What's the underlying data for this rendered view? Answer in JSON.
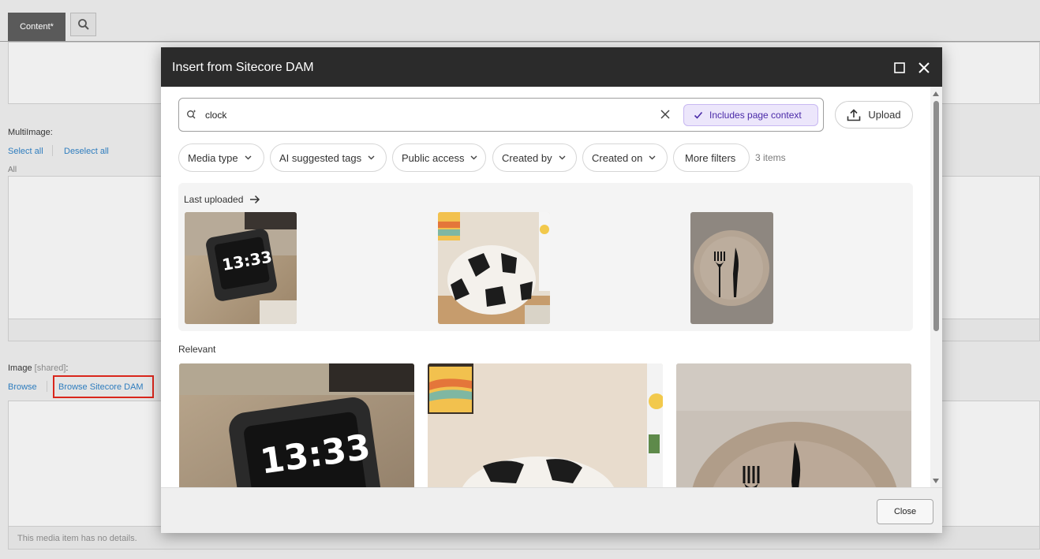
{
  "editor": {
    "tabs": [
      {
        "label": "Content*"
      }
    ],
    "multiimage": {
      "label": "MultiImage:",
      "select_all": "Select all",
      "deselect_all": "Deselect all",
      "filter_label": "All"
    },
    "image": {
      "label": "Image",
      "shared_tag": "[shared]",
      "suffix": ":",
      "browse": "Browse",
      "browse_dam": "Browse Sitecore DAM"
    },
    "no_details": "This media item has no details."
  },
  "dialog": {
    "title": "Insert from Sitecore DAM",
    "search": {
      "value": "clock",
      "context_chip": "Includes page context"
    },
    "upload_label": "Upload",
    "filters": [
      {
        "label": "Media type"
      },
      {
        "label": "AI suggested tags"
      },
      {
        "label": "Public access"
      },
      {
        "label": "Created by"
      },
      {
        "label": "Created on"
      }
    ],
    "more_filters": "More filters",
    "items_count": "3 items",
    "last_uploaded": {
      "title": "Last uploaded",
      "items": [
        {
          "subject": "alarm clock",
          "clock_text": "13:33"
        },
        {
          "subject": "soccer ball bean bag"
        },
        {
          "subject": "plate with fork and knife"
        }
      ]
    },
    "relevant": {
      "title": "Relevant",
      "items": [
        {
          "subject": "alarm clock",
          "clock_text": "13:33"
        },
        {
          "subject": "soccer ball bean bag"
        },
        {
          "subject": "plate with fork and knife"
        }
      ]
    },
    "close_label": "Close"
  },
  "colors": {
    "header_bg": "#2b2b2b",
    "chip_bg": "#ece6fb",
    "chip_text": "#4a2aa8",
    "link": "#2f7dbe",
    "highlight": "#d9261c"
  },
  "icons": [
    "search-icon",
    "maximize-icon",
    "close-icon",
    "ai-search-icon",
    "clear-icon",
    "check-icon",
    "upload-icon",
    "chevron-down-icon",
    "arrow-right-icon"
  ]
}
